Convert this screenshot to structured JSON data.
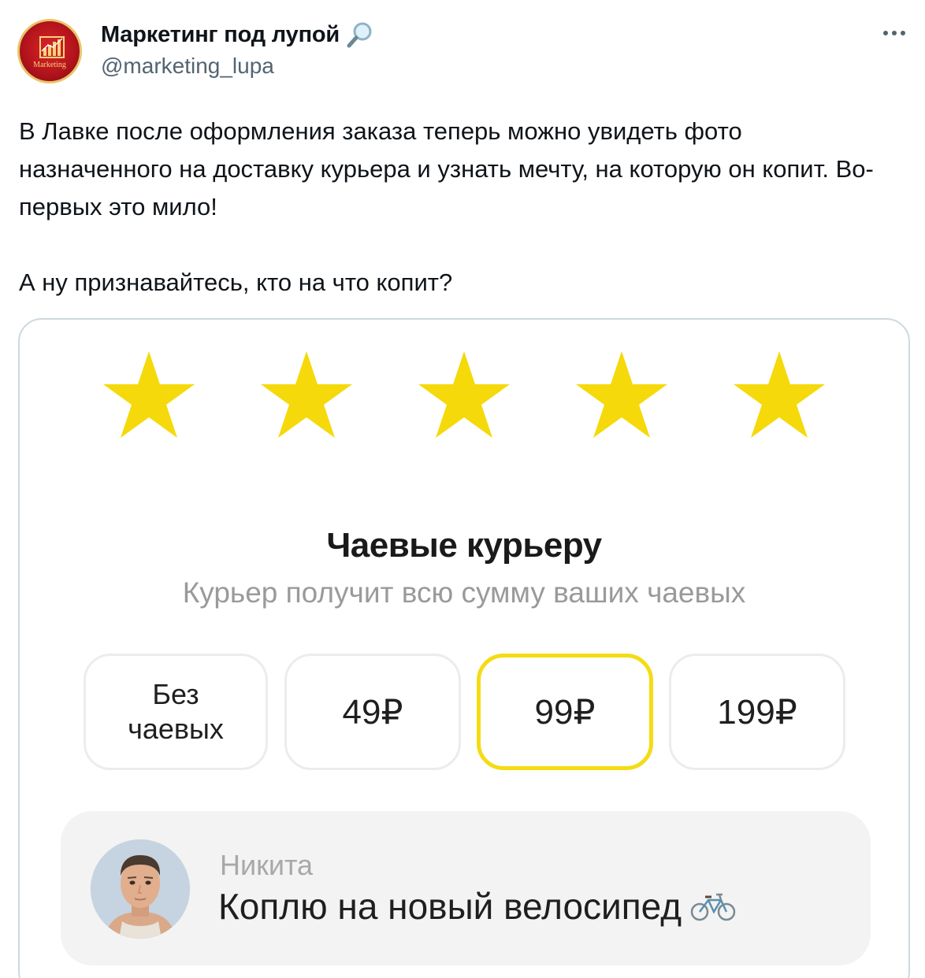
{
  "author": {
    "display_name": "Маркетинг под лупой",
    "handle": "@marketing_lupa",
    "avatar_text": "Marketing",
    "verified_icon": "magnifier-emoji"
  },
  "tweet": {
    "paragraphs": [
      "В Лавке после оформления заказа теперь можно увидеть фото назначенного на доставку курьера и узнать мечту, на которую он копит. Во-первых это мило!",
      "А ну признавайтесь, кто на что копит?"
    ]
  },
  "media": {
    "rating": {
      "value": 5,
      "max": 5,
      "star_color": "#f5d90a"
    },
    "tips_title": "Чаевые курьеру",
    "tips_subtitle": "Курьер получит всю сумму ваших чаевых",
    "tip_options": [
      "Без чаевых",
      "49₽",
      "99₽",
      "199₽"
    ],
    "selected_tip": "99₽",
    "courier": {
      "name": "Никита",
      "dream": "Коплю на новый велосипед",
      "dream_icon": "bicycle-icon"
    }
  },
  "colors": {
    "selected_border": "#f4dc14",
    "handle_gray": "#536471"
  }
}
